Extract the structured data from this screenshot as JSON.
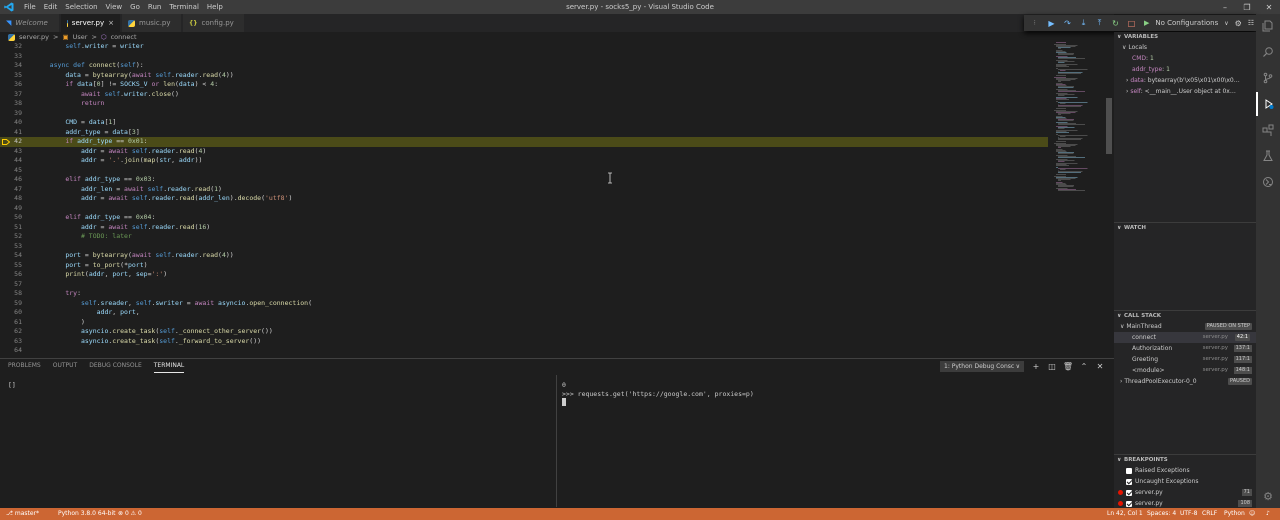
{
  "colors": {
    "accent": "#007acc",
    "statusbar": "#cc6633",
    "highlight_line": "#4b4b18",
    "breakpoint": "#e51400"
  },
  "window": {
    "title": "server.py - socks5_py - Visual Studio Code",
    "menus": [
      "File",
      "Edit",
      "Selection",
      "View",
      "Go",
      "Run",
      "Terminal",
      "Help"
    ]
  },
  "tabs": [
    {
      "label": "Welcome",
      "icon": "vscode-icon",
      "active": false
    },
    {
      "label": "server.py",
      "icon": "python-icon",
      "active": true,
      "close": "×"
    },
    {
      "label": "music.py",
      "icon": "python-icon",
      "active": false
    },
    {
      "label": "config.py",
      "icon": "json-icon",
      "active": false
    }
  ],
  "breadcrumb": {
    "file": "server.py",
    "sep": ">",
    "cls": "User",
    "method": "connect"
  },
  "debug": {
    "config_label": "No Configurations"
  },
  "editor": {
    "current_line": 42,
    "lines": [
      {
        "n": 32,
        "code": "        self.writer = writer"
      },
      {
        "n": 33,
        "code": ""
      },
      {
        "n": 34,
        "code": "    async def connect(self):"
      },
      {
        "n": 35,
        "code": "        data = bytearray(await self.reader.read(4))"
      },
      {
        "n": 36,
        "code": "        if data[0] != SOCKS_V or len(data) < 4:"
      },
      {
        "n": 37,
        "code": "            await self.writer.close()"
      },
      {
        "n": 38,
        "code": "            return"
      },
      {
        "n": 39,
        "code": ""
      },
      {
        "n": 40,
        "code": "        CMD = data[1]"
      },
      {
        "n": 41,
        "code": "        addr_type = data[3]"
      },
      {
        "n": 42,
        "code": "        if addr_type == 0x01:"
      },
      {
        "n": 43,
        "code": "            addr = await self.reader.read(4)"
      },
      {
        "n": 44,
        "code": "            addr = '.'.join(map(str, addr))"
      },
      {
        "n": 45,
        "code": ""
      },
      {
        "n": 46,
        "code": "        elif addr_type == 0x03:"
      },
      {
        "n": 47,
        "code": "            addr_len = await self.reader.read(1)"
      },
      {
        "n": 48,
        "code": "            addr = await self.reader.read(addr_len).decode('utf8')"
      },
      {
        "n": 49,
        "code": ""
      },
      {
        "n": 50,
        "code": "        elif addr_type == 0x04:"
      },
      {
        "n": 51,
        "code": "            addr = await self.reader.read(16)"
      },
      {
        "n": 52,
        "code": "            # TODO: later"
      },
      {
        "n": 53,
        "code": ""
      },
      {
        "n": 54,
        "code": "        port = bytearray(await self.reader.read(4))"
      },
      {
        "n": 55,
        "code": "        port = to_port(*port)"
      },
      {
        "n": 56,
        "code": "        print(addr, port, sep=':')"
      },
      {
        "n": 57,
        "code": ""
      },
      {
        "n": 58,
        "code": "        try:"
      },
      {
        "n": 59,
        "code": "            self.sreader, self.swriter = await asyncio.open_connection("
      },
      {
        "n": 60,
        "code": "                addr, port,"
      },
      {
        "n": 61,
        "code": "            )"
      },
      {
        "n": 62,
        "code": "            asyncio.create_task(self._connect_other_server())"
      },
      {
        "n": 63,
        "code": "            asyncio.create_task(self._forward_to_server())"
      },
      {
        "n": 64,
        "code": ""
      }
    ]
  },
  "panel": {
    "tabs": [
      "PROBLEMS",
      "OUTPUT",
      "DEBUG CONSOLE",
      "TERMINAL"
    ],
    "active_tab": "TERMINAL",
    "terminal_select": "1: Python Debug Consc",
    "left_prompt": "[]",
    "right_lines": [
      "0",
      ">>> requests.get('https://google.com', proxies=p)"
    ]
  },
  "sidebar": {
    "variables": {
      "header": "VARIABLES",
      "locals_label": "Locals",
      "items": [
        {
          "name": "CMD",
          "value": "1",
          "expandable": false
        },
        {
          "name": "addr_type",
          "value": "1",
          "expandable": false
        },
        {
          "name": "data",
          "value": "bytearray(b'\\x05\\x01\\x00\\x0…",
          "expandable": true
        },
        {
          "name": "self",
          "value": "<__main__.User object at 0x…",
          "expandable": true
        }
      ]
    },
    "watch": {
      "header": "WATCH"
    },
    "call_stack": {
      "header": "CALL STACK",
      "thread": "MainThread",
      "thread_status": "PAUSED ON STEP",
      "frames": [
        {
          "name": "connect",
          "file": "server.py",
          "pos": "42:1",
          "selected": true
        },
        {
          "name": "Authorization",
          "file": "server.py",
          "pos": "137:1",
          "selected": false
        },
        {
          "name": "Greeting",
          "file": "server.py",
          "pos": "117:1",
          "selected": false
        },
        {
          "name": "<module>",
          "file": "server.py",
          "pos": "148:1",
          "selected": false
        }
      ],
      "thread2": "ThreadPoolExecutor-0_0",
      "thread2_status": "PAUSED"
    },
    "breakpoints": {
      "header": "BREAKPOINTS",
      "items": [
        {
          "label": "Raised Exceptions",
          "checked": false,
          "dot": false,
          "count": ""
        },
        {
          "label": "Uncaught Exceptions",
          "checked": true,
          "dot": false,
          "count": ""
        },
        {
          "label": "server.py",
          "checked": true,
          "dot": true,
          "count": "71"
        },
        {
          "label": "server.py",
          "checked": true,
          "dot": true,
          "count": "108"
        }
      ]
    }
  },
  "statusbar": {
    "branch": "master*",
    "python": "Python 3.8.0 64-bit",
    "problems": "0 ⚠ 0",
    "position": "Ln 42, Col 1",
    "spaces": "Spaces: 4",
    "encoding": "UTF-8",
    "eol": "CRLF",
    "language": "Python"
  }
}
